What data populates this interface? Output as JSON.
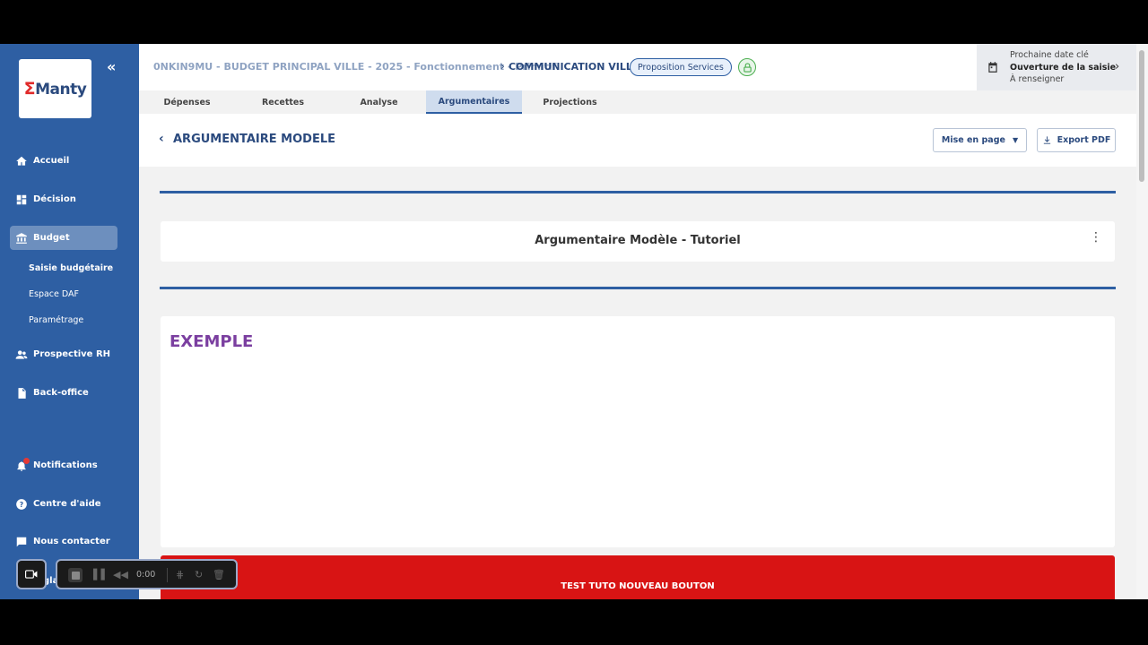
{
  "sidebar": {
    "logo": {
      "mark": "Σ",
      "text": "Manty"
    },
    "items": [
      {
        "label": "Accueil",
        "icon": "home-icon"
      },
      {
        "label": "Décision",
        "icon": "dashboard-icon"
      },
      {
        "label": "Budget",
        "icon": "bank-icon"
      },
      {
        "label": "Prospective RH",
        "icon": "people-icon"
      },
      {
        "label": "Back-office",
        "icon": "document-icon"
      }
    ],
    "sub_items": [
      "Saisie budgétaire",
      "Espace DAF",
      "Paramétrage"
    ],
    "bottom_items": [
      {
        "label": "Notifications",
        "icon": "bell-icon"
      },
      {
        "label": "Centre d'aide",
        "icon": "help-icon"
      },
      {
        "label": "Nous contacter",
        "icon": "chat-icon"
      },
      {
        "label": "Réglages",
        "icon": "settings-icon"
      }
    ]
  },
  "header": {
    "breadcrumb": "0NKIN9MU - BUDGET PRINCIPAL VILLE - 2025 - Fonctionnement - Primitif",
    "breadcrumb_sep": "›",
    "current": "COMMUNICATION VILLE",
    "status_pill": "Proposition Services",
    "next_date": {
      "label": "Prochaine date clé",
      "title": "Ouverture de la saisie",
      "value": "À renseigner"
    }
  },
  "tabs": [
    "Dépenses",
    "Recettes",
    "Analyse",
    "Argumentaires",
    "Projections"
  ],
  "active_tab": "Argumentaires",
  "titlebar": {
    "title": "ARGUMENTAIRE MODELE",
    "layout_button": "Mise en page",
    "export_button": "Export PDF"
  },
  "content": {
    "card_title": "Argumentaire Modèle - Tutoriel",
    "exemple_heading": "EXEMPLE",
    "red_button": "TEST TUTO NOUVEAU BOUTON"
  },
  "recorder": {
    "time": "0:00"
  },
  "colors": {
    "sidebar": "#2e5fa3",
    "primary_text": "#2b4a7e",
    "accent_red": "#d81414",
    "heading_purple": "#7b3fa0"
  }
}
